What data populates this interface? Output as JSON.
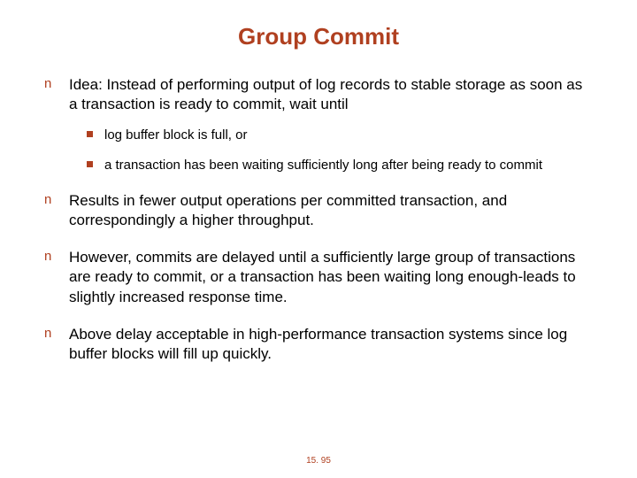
{
  "slide": {
    "title": "Group Commit",
    "bullets": [
      {
        "text": "Idea: Instead of performing output of log records to stable storage as soon as  a transaction is ready to commit, wait until",
        "sub": [
          "log buffer block is full, or",
          "a transaction has been waiting sufficiently long after being ready to commit"
        ]
      },
      {
        "text": "Results in fewer output operations per committed transaction, and correspondingly a higher throughput."
      },
      {
        "text": "However, commits are delayed until a sufficiently large group of transactions are ready to commit, or a transaction has been waiting long enough-leads to slightly increased response time."
      },
      {
        "text": "Above delay acceptable in high-performance transaction systems since log buffer blocks will fill up quickly."
      }
    ],
    "page_number": "15. 95"
  }
}
